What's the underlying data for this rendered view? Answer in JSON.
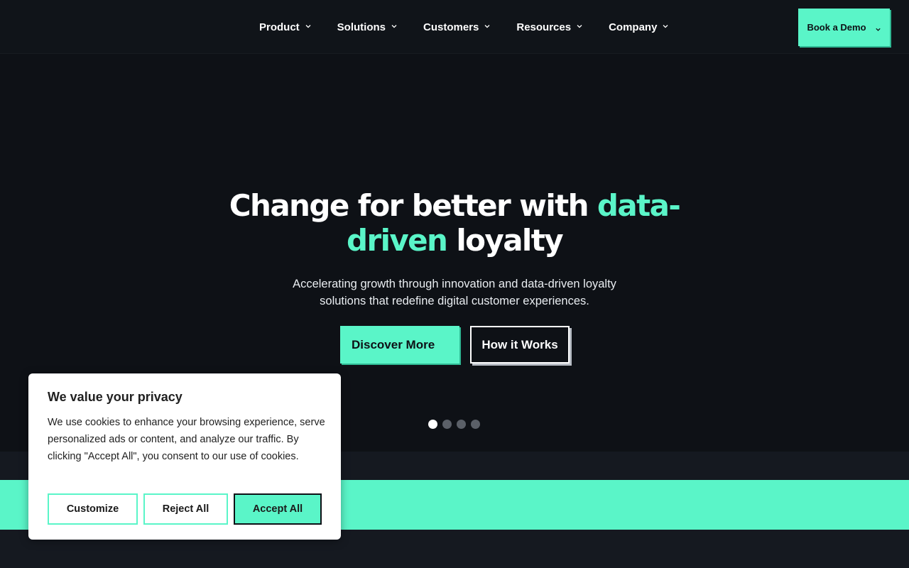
{
  "colors": {
    "background": "#0e1116",
    "header": "#101419",
    "accent": "#5af5c8",
    "text": "#ffffff"
  },
  "nav": {
    "items": [
      {
        "label": "Product",
        "icon": "chevron-down-icon"
      },
      {
        "label": "Solutions",
        "icon": "chevron-down-icon"
      },
      {
        "label": "Customers",
        "icon": "chevron-down-icon"
      },
      {
        "label": "Resources",
        "icon": "chevron-down-icon"
      },
      {
        "label": "Company",
        "icon": "chevron-down-icon"
      }
    ],
    "cta": {
      "label": "Book a Demo",
      "icon": "chevron-down-icon"
    }
  },
  "hero": {
    "title_part1": "Change for better with ",
    "title_accent1": "data-",
    "title_accent2": "driven",
    "title_part2": " loyalty",
    "subtitle_line1": "Accelerating growth through innovation and data-driven loyalty",
    "subtitle_line2": "solutions that redefine digital customer experiences.",
    "primary_button": "Discover More",
    "secondary_button": "How it Works",
    "carousel": {
      "slides": 4,
      "active": 1
    }
  },
  "cookie_banner": {
    "title": "We value your privacy",
    "body": "We use cookies to enhance your browsing experience, serve personalized ads or content, and analyze our traffic. By clicking \"Accept All\", you consent to our use of cookies.",
    "buttons": {
      "customize": "Customize",
      "reject": "Reject All",
      "accept": "Accept All"
    }
  }
}
